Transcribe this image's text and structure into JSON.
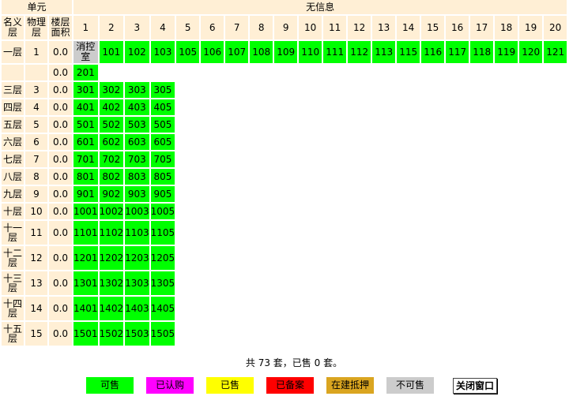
{
  "header": {
    "unit_label": "单元",
    "building_label": "无信息",
    "col_name": "名义层",
    "col_phys": "物理层",
    "col_area": "楼层面积",
    "columns": [
      "1",
      "2",
      "3",
      "4",
      "5",
      "6",
      "7",
      "8",
      "9",
      "10",
      "11",
      "12",
      "13",
      "14",
      "15",
      "16",
      "17",
      "18",
      "19",
      "20"
    ]
  },
  "rows": [
    {
      "name": "一层",
      "phys": "1",
      "area": "0.0",
      "rooms": [
        "消控室",
        "101",
        "102",
        "103",
        "105",
        "106",
        "107",
        "108",
        "109",
        "110",
        "111",
        "112",
        "113",
        "115",
        "116",
        "117",
        "118",
        "119",
        "120",
        "121"
      ]
    },
    {
      "name": "",
      "phys": "",
      "area": "0.0",
      "rooms": [
        "201"
      ]
    },
    {
      "name": "三层",
      "phys": "3",
      "area": "0.0",
      "rooms": [
        "301",
        "302",
        "303",
        "305"
      ]
    },
    {
      "name": "四层",
      "phys": "4",
      "area": "0.0",
      "rooms": [
        "401",
        "402",
        "403",
        "405"
      ]
    },
    {
      "name": "五层",
      "phys": "5",
      "area": "0.0",
      "rooms": [
        "501",
        "502",
        "503",
        "505"
      ]
    },
    {
      "name": "六层",
      "phys": "6",
      "area": "0.0",
      "rooms": [
        "601",
        "602",
        "603",
        "605"
      ]
    },
    {
      "name": "七层",
      "phys": "7",
      "area": "0.0",
      "rooms": [
        "701",
        "702",
        "703",
        "705"
      ]
    },
    {
      "name": "八层",
      "phys": "8",
      "area": "0.0",
      "rooms": [
        "801",
        "802",
        "803",
        "805"
      ]
    },
    {
      "name": "九层",
      "phys": "9",
      "area": "0.0",
      "rooms": [
        "901",
        "902",
        "903",
        "905"
      ]
    },
    {
      "name": "十层",
      "phys": "10",
      "area": "0.0",
      "rooms": [
        "1001",
        "1002",
        "1003",
        "1005"
      ]
    },
    {
      "name": "十一层",
      "phys": "11",
      "area": "0.0",
      "rooms": [
        "1101",
        "1102",
        "1103",
        "1105"
      ]
    },
    {
      "name": "十二层",
      "phys": "12",
      "area": "0.0",
      "rooms": [
        "1201",
        "1202",
        "1203",
        "1205"
      ]
    },
    {
      "name": "十三层",
      "phys": "13",
      "area": "0.0",
      "rooms": [
        "1301",
        "1302",
        "1303",
        "1305"
      ]
    },
    {
      "name": "十四层",
      "phys": "14",
      "area": "0.0",
      "rooms": [
        "1401",
        "1402",
        "1403",
        "1405"
      ]
    },
    {
      "name": "十五层",
      "phys": "15",
      "area": "0.0",
      "rooms": [
        "1501",
        "1502",
        "1503",
        "1505"
      ]
    }
  ],
  "summary": "共 73 套，已售 0 套。",
  "legend": [
    {
      "label": "可售",
      "color": "#00FF00"
    },
    {
      "label": "已认购",
      "color": "#FF00FF"
    },
    {
      "label": "已售",
      "color": "#FFFF00"
    },
    {
      "label": "已备案",
      "color": "#FF0000"
    },
    {
      "label": "在建抵押",
      "color": "#DAA520"
    },
    {
      "label": "不可售",
      "color": "#CCCCCC"
    }
  ],
  "close_button": "关闭窗口"
}
